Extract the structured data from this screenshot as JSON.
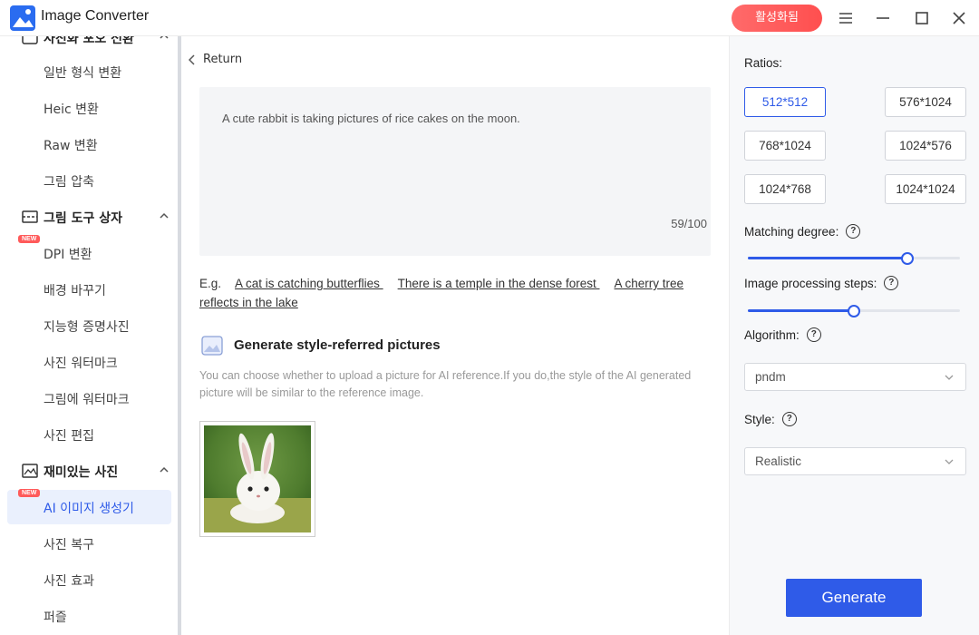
{
  "app": {
    "title": "Image Converter",
    "activate_label": "활성화됨"
  },
  "sidebar": {
    "partial_section_label": "사진화 포오 전환",
    "items_top": [
      {
        "label": "일반 형식 변환"
      },
      {
        "label": "Heic 변환"
      },
      {
        "label": "Raw 변환"
      },
      {
        "label": "그림 압축"
      }
    ],
    "section_tools": {
      "label": "그림 도구 상자"
    },
    "items_tools": [
      {
        "label": "DPI 변환",
        "badge": "NEW"
      },
      {
        "label": "배경 바꾸기"
      },
      {
        "label": "지능형 증명사진"
      },
      {
        "label": "사진 워터마크"
      },
      {
        "label": "그림에 워터마크"
      },
      {
        "label": "사진 편집"
      }
    ],
    "section_fun": {
      "label": "재미있는 사진"
    },
    "items_fun": [
      {
        "label": "AI 이미지 생성기",
        "badge": "NEW",
        "active": true
      },
      {
        "label": "사진 복구"
      },
      {
        "label": "사진 효과"
      },
      {
        "label": "퍼즐"
      }
    ]
  },
  "main": {
    "return_label": "Return",
    "prompt": {
      "text": "A cute rabbit is taking pictures of rice cakes on the moon.",
      "count": "59/100"
    },
    "examples": {
      "prefix": "E.g.",
      "items": [
        "A cat is catching butterflies ",
        "There is a temple in the dense forest ",
        "A cherry tree reflects in the lake"
      ]
    },
    "style_ref": {
      "title": "Generate style-referred pictures",
      "desc": "You can choose whether to upload a picture for AI reference.If you do,the style of the AI generated picture will be similar to the reference image."
    }
  },
  "panel": {
    "ratios_label": "Ratios:",
    "ratios": [
      "512*512",
      "576*1024",
      "768*1024",
      "1024*576",
      "1024*768",
      "1024*1024"
    ],
    "selected_ratio": "512*512",
    "matching_label": "Matching degree:",
    "matching_value": 0.75,
    "steps_label": "Image processing steps:",
    "steps_value": 0.5,
    "algorithm_label": "Algorithm:",
    "algorithm_value": "pndm",
    "style_label": "Style:",
    "style_value": "Realistic",
    "generate_label": "Generate"
  },
  "colors": {
    "accent": "#2f5be8",
    "activate": "#ff5a5a",
    "new_badge": "#ff5a5a"
  }
}
